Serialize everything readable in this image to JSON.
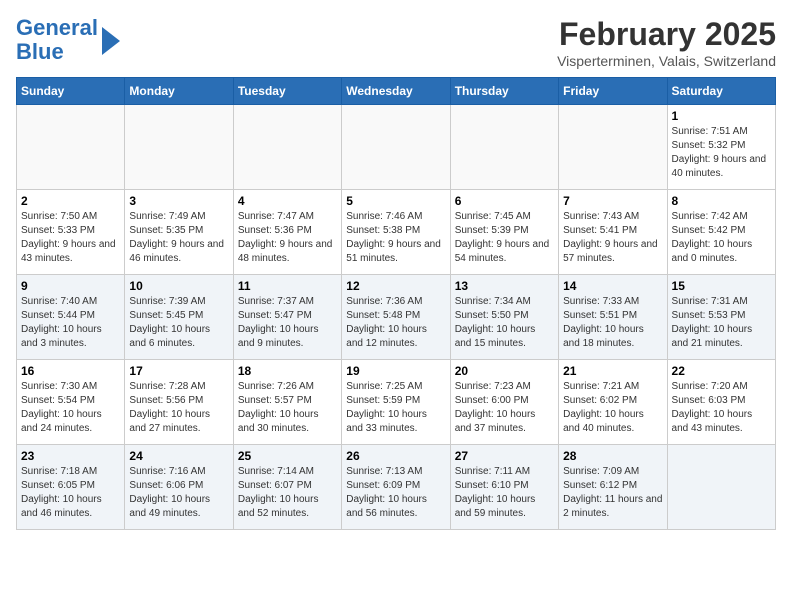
{
  "logo": {
    "line1": "General",
    "line2": "Blue"
  },
  "title": "February 2025",
  "location": "Visperterminen, Valais, Switzerland",
  "days_of_week": [
    "Sunday",
    "Monday",
    "Tuesday",
    "Wednesday",
    "Thursday",
    "Friday",
    "Saturday"
  ],
  "weeks": [
    {
      "shaded": false,
      "days": [
        {
          "number": "",
          "info": ""
        },
        {
          "number": "",
          "info": ""
        },
        {
          "number": "",
          "info": ""
        },
        {
          "number": "",
          "info": ""
        },
        {
          "number": "",
          "info": ""
        },
        {
          "number": "",
          "info": ""
        },
        {
          "number": "1",
          "info": "Sunrise: 7:51 AM\nSunset: 5:32 PM\nDaylight: 9 hours and 40 minutes."
        }
      ]
    },
    {
      "shaded": false,
      "days": [
        {
          "number": "2",
          "info": "Sunrise: 7:50 AM\nSunset: 5:33 PM\nDaylight: 9 hours and 43 minutes."
        },
        {
          "number": "3",
          "info": "Sunrise: 7:49 AM\nSunset: 5:35 PM\nDaylight: 9 hours and 46 minutes."
        },
        {
          "number": "4",
          "info": "Sunrise: 7:47 AM\nSunset: 5:36 PM\nDaylight: 9 hours and 48 minutes."
        },
        {
          "number": "5",
          "info": "Sunrise: 7:46 AM\nSunset: 5:38 PM\nDaylight: 9 hours and 51 minutes."
        },
        {
          "number": "6",
          "info": "Sunrise: 7:45 AM\nSunset: 5:39 PM\nDaylight: 9 hours and 54 minutes."
        },
        {
          "number": "7",
          "info": "Sunrise: 7:43 AM\nSunset: 5:41 PM\nDaylight: 9 hours and 57 minutes."
        },
        {
          "number": "8",
          "info": "Sunrise: 7:42 AM\nSunset: 5:42 PM\nDaylight: 10 hours and 0 minutes."
        }
      ]
    },
    {
      "shaded": true,
      "days": [
        {
          "number": "9",
          "info": "Sunrise: 7:40 AM\nSunset: 5:44 PM\nDaylight: 10 hours and 3 minutes."
        },
        {
          "number": "10",
          "info": "Sunrise: 7:39 AM\nSunset: 5:45 PM\nDaylight: 10 hours and 6 minutes."
        },
        {
          "number": "11",
          "info": "Sunrise: 7:37 AM\nSunset: 5:47 PM\nDaylight: 10 hours and 9 minutes."
        },
        {
          "number": "12",
          "info": "Sunrise: 7:36 AM\nSunset: 5:48 PM\nDaylight: 10 hours and 12 minutes."
        },
        {
          "number": "13",
          "info": "Sunrise: 7:34 AM\nSunset: 5:50 PM\nDaylight: 10 hours and 15 minutes."
        },
        {
          "number": "14",
          "info": "Sunrise: 7:33 AM\nSunset: 5:51 PM\nDaylight: 10 hours and 18 minutes."
        },
        {
          "number": "15",
          "info": "Sunrise: 7:31 AM\nSunset: 5:53 PM\nDaylight: 10 hours and 21 minutes."
        }
      ]
    },
    {
      "shaded": false,
      "days": [
        {
          "number": "16",
          "info": "Sunrise: 7:30 AM\nSunset: 5:54 PM\nDaylight: 10 hours and 24 minutes."
        },
        {
          "number": "17",
          "info": "Sunrise: 7:28 AM\nSunset: 5:56 PM\nDaylight: 10 hours and 27 minutes."
        },
        {
          "number": "18",
          "info": "Sunrise: 7:26 AM\nSunset: 5:57 PM\nDaylight: 10 hours and 30 minutes."
        },
        {
          "number": "19",
          "info": "Sunrise: 7:25 AM\nSunset: 5:59 PM\nDaylight: 10 hours and 33 minutes."
        },
        {
          "number": "20",
          "info": "Sunrise: 7:23 AM\nSunset: 6:00 PM\nDaylight: 10 hours and 37 minutes."
        },
        {
          "number": "21",
          "info": "Sunrise: 7:21 AM\nSunset: 6:02 PM\nDaylight: 10 hours and 40 minutes."
        },
        {
          "number": "22",
          "info": "Sunrise: 7:20 AM\nSunset: 6:03 PM\nDaylight: 10 hours and 43 minutes."
        }
      ]
    },
    {
      "shaded": true,
      "days": [
        {
          "number": "23",
          "info": "Sunrise: 7:18 AM\nSunset: 6:05 PM\nDaylight: 10 hours and 46 minutes."
        },
        {
          "number": "24",
          "info": "Sunrise: 7:16 AM\nSunset: 6:06 PM\nDaylight: 10 hours and 49 minutes."
        },
        {
          "number": "25",
          "info": "Sunrise: 7:14 AM\nSunset: 6:07 PM\nDaylight: 10 hours and 52 minutes."
        },
        {
          "number": "26",
          "info": "Sunrise: 7:13 AM\nSunset: 6:09 PM\nDaylight: 10 hours and 56 minutes."
        },
        {
          "number": "27",
          "info": "Sunrise: 7:11 AM\nSunset: 6:10 PM\nDaylight: 10 hours and 59 minutes."
        },
        {
          "number": "28",
          "info": "Sunrise: 7:09 AM\nSunset: 6:12 PM\nDaylight: 11 hours and 2 minutes."
        },
        {
          "number": "",
          "info": ""
        }
      ]
    }
  ]
}
